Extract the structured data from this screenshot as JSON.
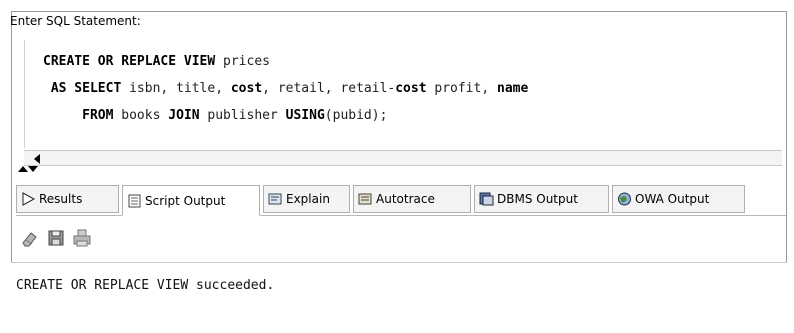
{
  "window": {
    "header_label": "Enter SQL Statement:"
  },
  "editor": {
    "lines": [
      [
        {
          "t": "CREATE OR REPLACE VIEW",
          "kw": true
        },
        {
          "t": " prices",
          "kw": false
        }
      ],
      [
        {
          "t": " AS SELECT",
          "kw": true
        },
        {
          "t": " isbn, title, ",
          "kw": false
        },
        {
          "t": "cost",
          "kw": true
        },
        {
          "t": ", retail, retail-",
          "kw": false
        },
        {
          "t": "cost",
          "kw": true
        },
        {
          "t": " profit, ",
          "kw": false
        },
        {
          "t": "name",
          "kw": true
        }
      ],
      [
        {
          "t": "     FROM",
          "kw": true
        },
        {
          "t": " books ",
          "kw": false
        },
        {
          "t": "JOIN",
          "kw": true
        },
        {
          "t": " publisher ",
          "kw": false
        },
        {
          "t": "USING",
          "kw": true
        },
        {
          "t": "(pubid);",
          "kw": false
        }
      ]
    ]
  },
  "tabs": [
    {
      "label": "Results",
      "icon": "play-icon",
      "active": false
    },
    {
      "label": "Script Output",
      "icon": "script-icon",
      "active": true
    },
    {
      "label": "Explain",
      "icon": "explain-icon",
      "active": false
    },
    {
      "label": "Autotrace",
      "icon": "autotrace-icon",
      "active": false
    },
    {
      "label": "DBMS Output",
      "icon": "dbms-icon",
      "active": false
    },
    {
      "label": "OWA Output",
      "icon": "owa-icon",
      "active": false
    }
  ],
  "toolbar": {
    "buttons": [
      "eraser-icon",
      "save-icon",
      "print-icon"
    ]
  },
  "output": {
    "text": "CREATE OR REPLACE VIEW succeeded."
  },
  "colors": {
    "keyword": "#000000",
    "border": "#9a9a9a",
    "tab_bg": "#f4f4f4"
  }
}
